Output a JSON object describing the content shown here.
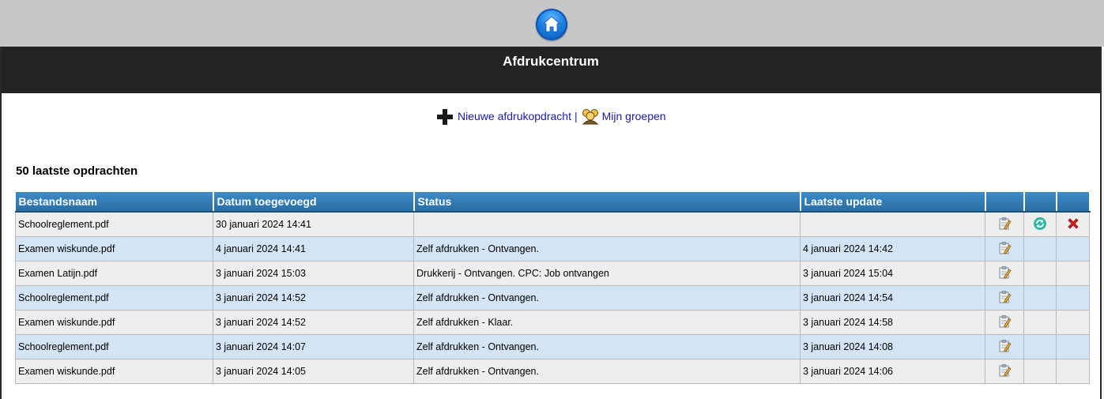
{
  "header": {
    "home_icon": "home-icon",
    "title": "Afdrukcentrum"
  },
  "actions": {
    "new_job_icon": "plus-icon",
    "new_job_label": "Nieuwe afdrukopdracht",
    "separator": "|",
    "groups_icon": "groups-icon",
    "groups_label": "Mijn groepen"
  },
  "section": {
    "title": "50 laatste opdrachten"
  },
  "table": {
    "columns": [
      "Bestandsnaam",
      "Datum toegevoegd",
      "Status",
      "Laatste update",
      "",
      "",
      ""
    ],
    "rows": [
      {
        "file": "Schoolreglement.pdf",
        "added": "30 januari 2024 14:41",
        "status": "",
        "updated": "",
        "actions": [
          "edit-icon",
          "refresh-icon",
          "delete-icon"
        ]
      },
      {
        "file": "Examen wiskunde.pdf",
        "added": "4 januari 2024 14:41",
        "status": "Zelf afdrukken - Ontvangen.",
        "updated": "4 januari 2024 14:42",
        "actions": [
          "edit-icon"
        ]
      },
      {
        "file": "Examen Latijn.pdf",
        "added": "3 januari 2024 15:03",
        "status": "Drukkerij - Ontvangen. CPC: Job ontvangen",
        "updated": "3 januari 2024 15:04",
        "actions": [
          "edit-icon"
        ]
      },
      {
        "file": "Schoolreglement.pdf",
        "added": "3 januari 2024 14:52",
        "status": "Zelf afdrukken - Ontvangen.",
        "updated": "3 januari 2024 14:54",
        "actions": [
          "edit-icon"
        ]
      },
      {
        "file": "Examen wiskunde.pdf",
        "added": "3 januari 2024 14:52",
        "status": "Zelf afdrukken - Klaar.",
        "updated": "3 januari 2024 14:58",
        "actions": [
          "edit-icon"
        ]
      },
      {
        "file": "Schoolreglement.pdf",
        "added": "3 januari 2024 14:07",
        "status": "Zelf afdrukken - Ontvangen.",
        "updated": "3 januari 2024 14:08",
        "actions": [
          "edit-icon"
        ]
      },
      {
        "file": "Examen wiskunde.pdf",
        "added": "3 januari 2024 14:05",
        "status": "Zelf afdrukken - Ontvangen.",
        "updated": "3 januari 2024 14:06",
        "actions": [
          "edit-icon"
        ]
      }
    ]
  },
  "colors": {
    "topbar": "#c8c7c8",
    "titlebar": "#232323",
    "header_blue": "#3d8bc7",
    "row_odd": "#eeeeee",
    "row_even": "#d3e4f4",
    "link": "#1a1aa6"
  }
}
